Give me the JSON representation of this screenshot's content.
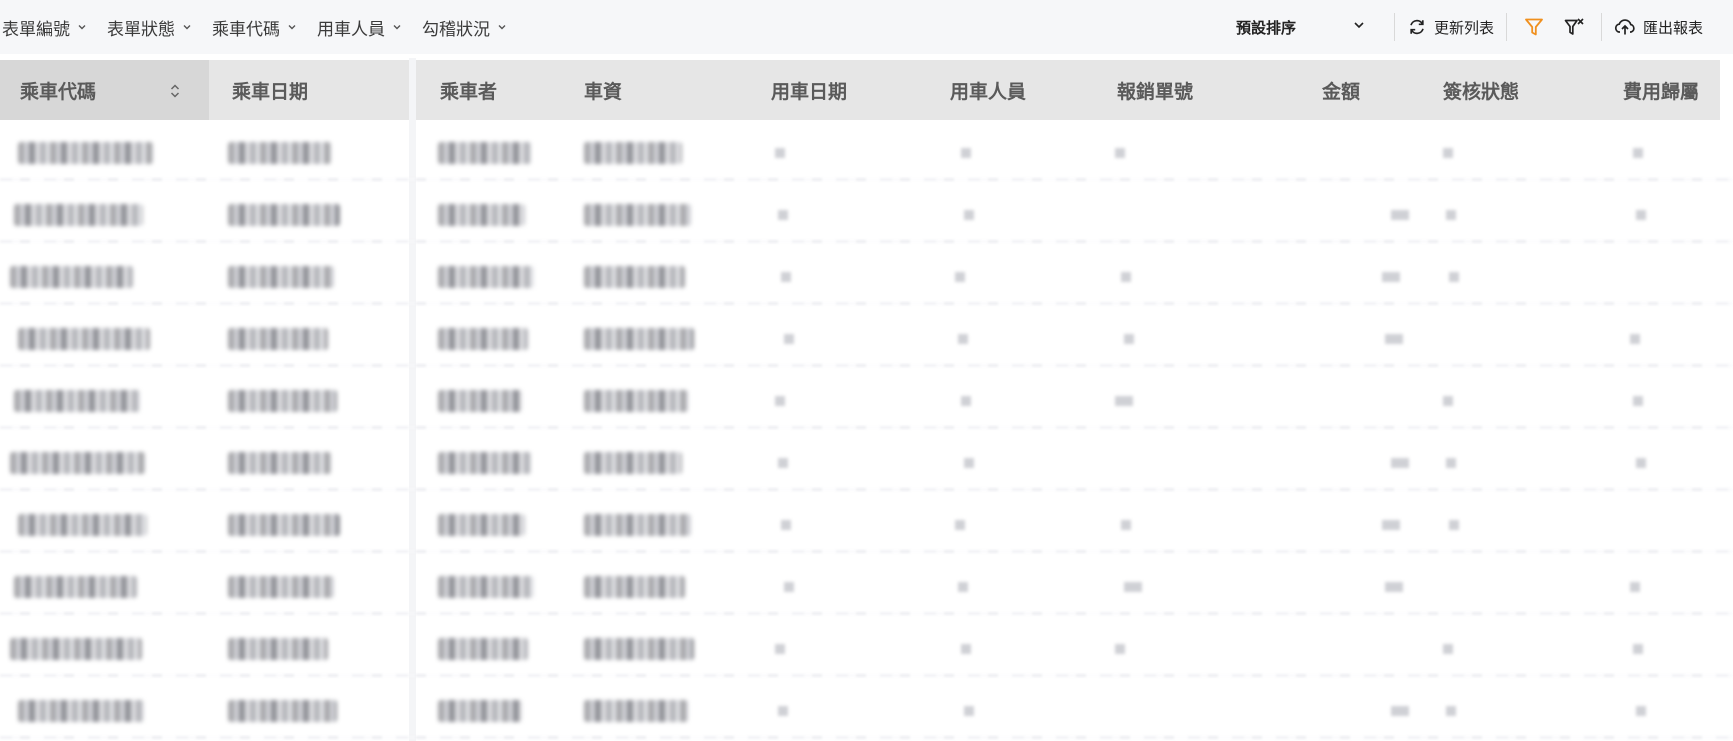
{
  "toolbar": {
    "filters": [
      "表單編號",
      "表單狀態",
      "乘車代碼",
      "用車人員",
      "勾稽狀況"
    ],
    "sort_select": {
      "value": "預設排序"
    },
    "refresh_label": "更新列表",
    "export_label": "匯出報表",
    "icons": [
      "chevron-down-icon",
      "refresh-icon",
      "filter-icon",
      "clear-filter-icon",
      "upload-cloud-icon"
    ],
    "colors": {
      "filter_active": "#f0901e",
      "toolbar_bg": "#f6f7f9",
      "header_bg": "#e6e6e6",
      "sorted_header_bg": "#d7d7d7"
    }
  },
  "table": {
    "columns": [
      "乘車代碼",
      "乘車日期",
      "乘車者",
      "車資",
      "用車日期",
      "用車人員",
      "報銷單號",
      "金額",
      "簽核狀態",
      "費用歸屬"
    ],
    "sorted_column": "乘車代碼",
    "frozen_columns": 2,
    "row_count_visible": 10,
    "cell_values_obscured": true
  }
}
